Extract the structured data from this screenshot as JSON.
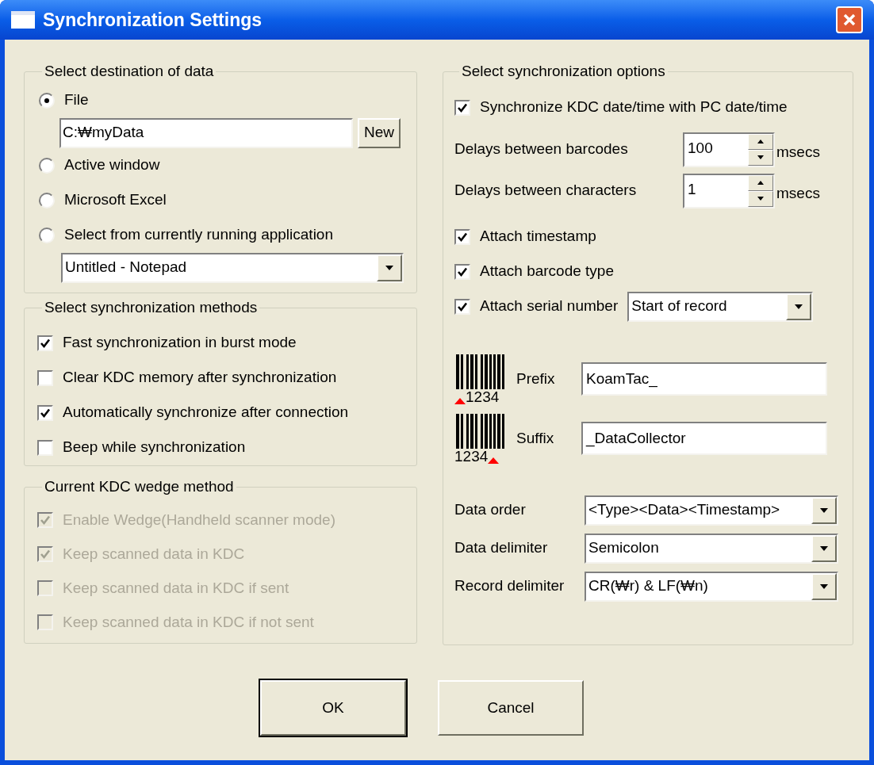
{
  "window": {
    "title": "Synchronization Settings"
  },
  "destination": {
    "legend": "Select destination of data",
    "options": [
      {
        "label": "File",
        "selected": true,
        "field": "C:₩myData",
        "button": "New"
      },
      {
        "label": "Active window",
        "selected": false
      },
      {
        "label": "Microsoft Excel",
        "selected": false
      },
      {
        "label": "Select from currently running application",
        "selected": false,
        "dropdown": "Untitled - Notepad"
      }
    ]
  },
  "methods": {
    "legend": "Select synchronization methods",
    "items": [
      {
        "label": "Fast synchronization in burst mode",
        "checked": true
      },
      {
        "label": "Clear KDC memory after synchronization",
        "checked": false
      },
      {
        "label": "Automatically synchronize after connection",
        "checked": true
      },
      {
        "label": "Beep while synchronization",
        "checked": false
      }
    ]
  },
  "wedge": {
    "legend": "Current KDC wedge method",
    "disabled": true,
    "items": [
      {
        "label": "Enable Wedge(Handheld scanner mode)",
        "checked": true
      },
      {
        "label": "Keep scanned data in KDC",
        "checked": true
      },
      {
        "label": "Keep scanned data in KDC if sent",
        "checked": false
      },
      {
        "label": "Keep scanned data in KDC if not sent",
        "checked": false
      }
    ]
  },
  "options": {
    "legend": "Select synchronization options",
    "sync_time": {
      "label": "Synchronize KDC date/time with PC date/time",
      "checked": true
    },
    "delays": [
      {
        "label": "Delays between barcodes",
        "value": "100",
        "unit": "msecs"
      },
      {
        "label": "Delays between characters",
        "value": "1",
        "unit": "msecs"
      }
    ],
    "attach": [
      {
        "label": "Attach timestamp",
        "checked": true
      },
      {
        "label": "Attach barcode type",
        "checked": true
      },
      {
        "label": "Attach serial number",
        "checked": true,
        "dropdown": "Start of record"
      }
    ],
    "affixes": [
      {
        "kind": "prefix",
        "caption": "1234",
        "label": "Prefix",
        "value": "KoamTac_"
      },
      {
        "kind": "suffix",
        "caption": "1234",
        "label": "Suffix",
        "value": "_DataCollector"
      }
    ],
    "selects": [
      {
        "label": "Data order",
        "value": "<Type><Data><Timestamp>"
      },
      {
        "label": "Data delimiter",
        "value": "Semicolon"
      },
      {
        "label": "Record delimiter",
        "value": "CR(₩r) & LF(₩n)"
      }
    ]
  },
  "buttons": [
    {
      "label": "OK",
      "default": true
    },
    {
      "label": "Cancel",
      "default": false
    }
  ]
}
